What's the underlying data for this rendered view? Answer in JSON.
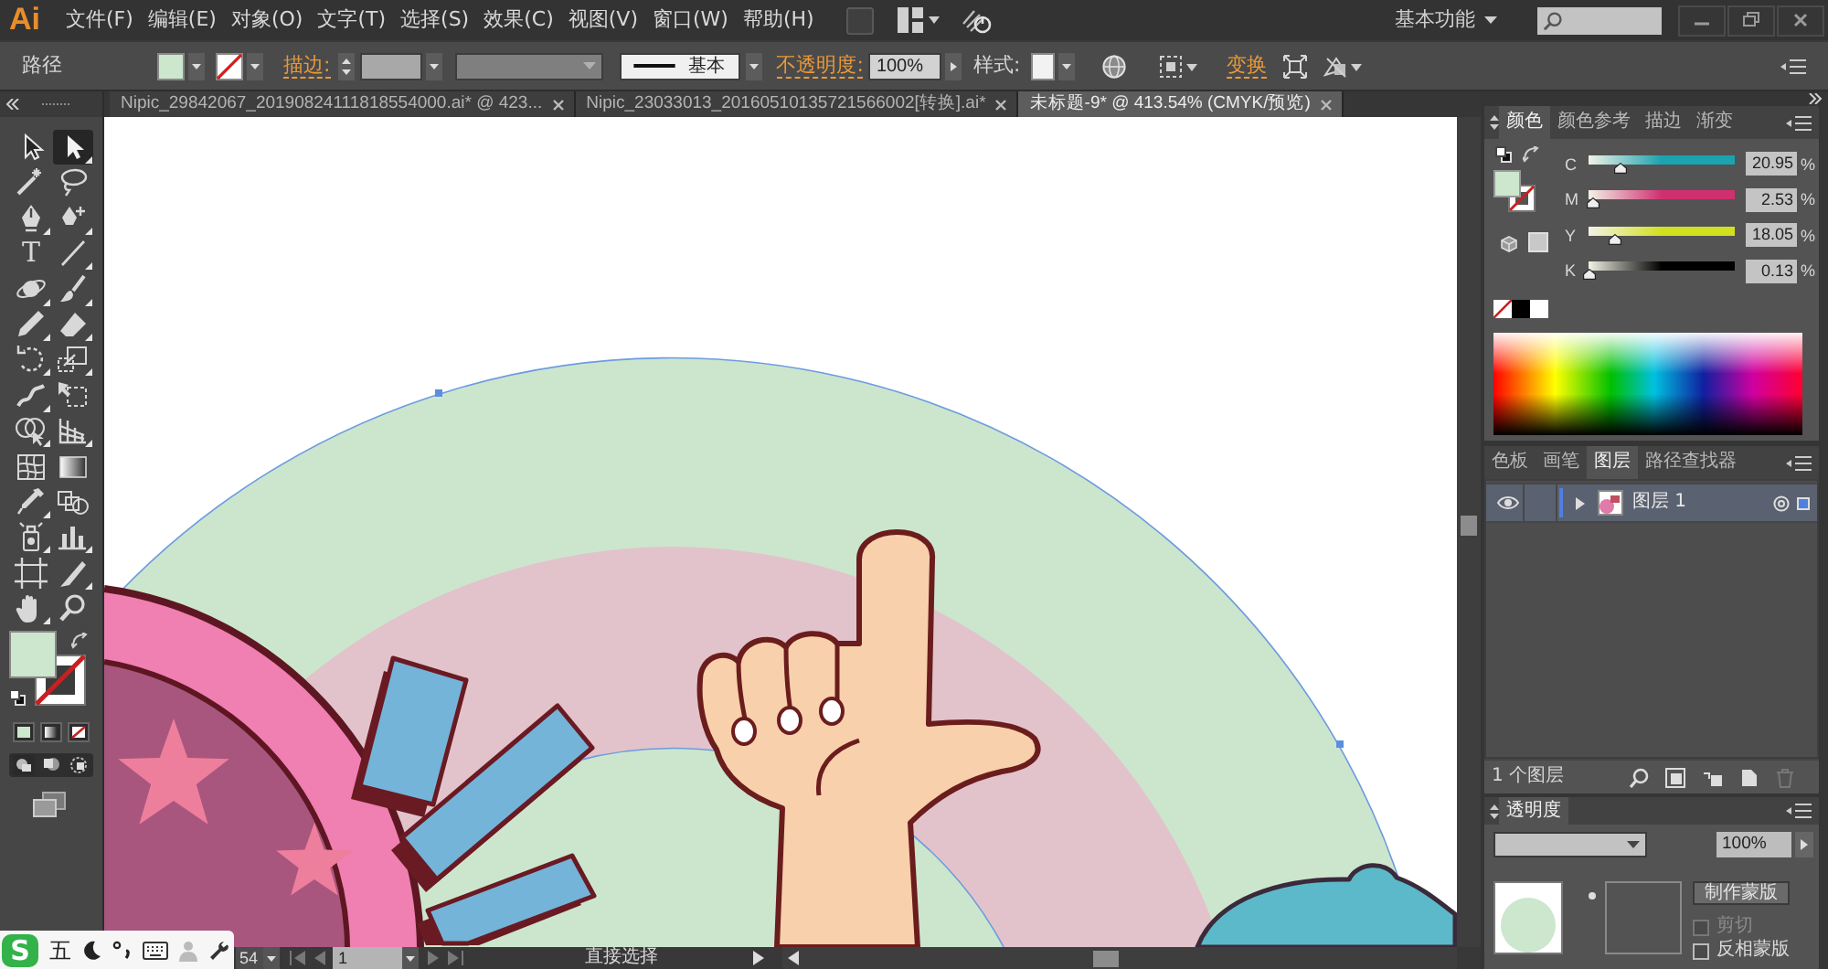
{
  "menu_bar": {
    "logo": "Ai",
    "items": [
      "文件(F)",
      "编辑(E)",
      "对象(O)",
      "文字(T)",
      "选择(S)",
      "效果(C)",
      "视图(V)",
      "窗口(W)",
      "帮助(H)"
    ],
    "workspace": "基本功能"
  },
  "control_bar": {
    "selection_type": "路径",
    "fill": {
      "color": "#cde6ce"
    },
    "stroke_label": "描边:",
    "stroke_profile": "基本",
    "opacity_label": "不透明度:",
    "opacity": "100%",
    "style_label": "样式:",
    "transform_label": "变换"
  },
  "document_tabs": [
    {
      "label": "Nipic_29842067_20190824111818554000.ai* @ 423...",
      "selected": false
    },
    {
      "label": "Nipic_23033013_20160510135721566002[转换].ai*",
      "selected": false
    },
    {
      "label": "未标题-9* @ 413.54% (CMYK/预览)",
      "selected": true
    }
  ],
  "toolbox": {
    "tools": [
      {
        "selected": false
      },
      {
        "selected": true
      },
      {
        "selected": false
      },
      {
        "selected": false
      },
      {
        "selected": false
      },
      {
        "selected": false
      },
      {
        "label": "T",
        "selected": false
      },
      {
        "selected": false
      },
      {
        "selected": false
      },
      {
        "selected": false
      },
      {
        "selected": false
      },
      {
        "selected": false
      },
      {
        "selected": false
      },
      {
        "selected": false
      },
      {
        "selected": false
      },
      {
        "selected": false
      },
      {
        "selected": false
      },
      {
        "selected": false
      },
      {
        "selected": false
      },
      {
        "selected": false
      },
      {
        "selected": false
      },
      {
        "selected": false
      },
      {
        "selected": false
      },
      {
        "selected": false
      },
      {
        "selected": false
      },
      {
        "selected": false
      },
      {
        "selected": false
      },
      {
        "selected": false
      }
    ],
    "fill": {
      "color": "#cde6ce"
    }
  },
  "color_panel": {
    "tabs": [
      {
        "label": "颜色",
        "selected": true
      },
      {
        "label": "颜色参考",
        "selected": false
      },
      {
        "label": "描边",
        "selected": false
      },
      {
        "label": "渐变",
        "selected": false
      }
    ],
    "fill": {
      "color": "#cde6ce"
    },
    "channels": [
      {
        "name": "C",
        "level": 0.2095,
        "value": "20.95",
        "unit": "%",
        "color": "#1aa3b0"
      },
      {
        "name": "M",
        "level": 0.0253,
        "value": "2.53",
        "unit": "%",
        "color": "#cf3070"
      },
      {
        "name": "Y",
        "level": 0.1805,
        "value": "18.05",
        "unit": "%",
        "color": "#d2e020"
      },
      {
        "name": "K",
        "level": 0.0013,
        "value": "0.13",
        "unit": "%",
        "color": "#000000"
      }
    ]
  },
  "layers_panel": {
    "tabs": [
      {
        "label": "色板",
        "selected": false
      },
      {
        "label": "画笔",
        "selected": false
      },
      {
        "label": "图层",
        "selected": true
      },
      {
        "label": "路径查找器",
        "selected": false
      }
    ],
    "layers": [
      {
        "name": "图层 1",
        "visible": true,
        "color": "#4f7fe0"
      }
    ],
    "count": "1 个图层"
  },
  "transparency_panel": {
    "title": "透明度",
    "opacity": "100%",
    "mask_button": "制作蒙版",
    "options": [
      {
        "label": "剪切",
        "checked": false,
        "disabled": true
      },
      {
        "label": "反相蒙版",
        "checked": false,
        "disabled": false
      }
    ]
  },
  "status_bar": {
    "zoom": "54",
    "page": "1",
    "tool": "直接选择"
  },
  "ime_bar": {
    "logo": "S",
    "mode": "五"
  }
}
